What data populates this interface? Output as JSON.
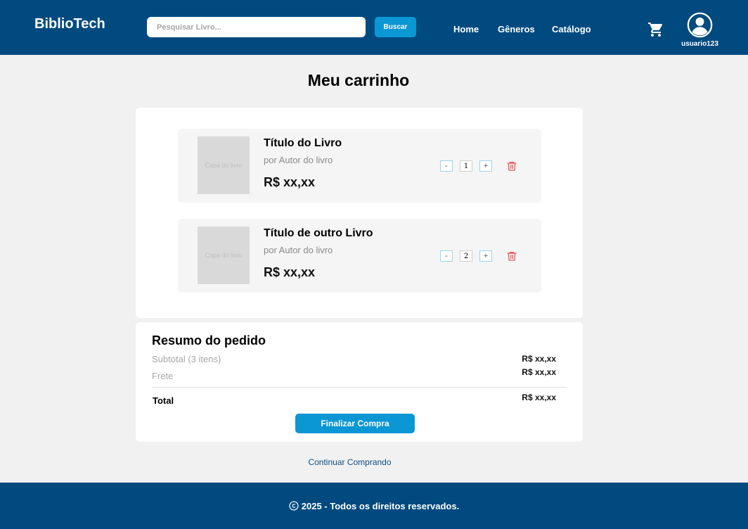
{
  "header": {
    "brand": "BiblioTech",
    "search_placeholder": "Pesquisar Livro...",
    "search_button": "Buscar",
    "nav": [
      {
        "label": "Home"
      },
      {
        "label": "Gêneros"
      },
      {
        "label": "Catálogo"
      }
    ],
    "username": "usuario123",
    "icons": {
      "cart": "cart-icon",
      "user": "user-circle-icon"
    }
  },
  "page_title": "Meu carrinho",
  "cart_items": [
    {
      "cover_text": "Capa do livro",
      "title": "Título do Livro",
      "author": "por Autor do livro",
      "price": "R$ xx,xx",
      "quantity": "1",
      "minus": "-",
      "plus": "+"
    },
    {
      "cover_text": "Capa do livro",
      "title": "Título de outro Livro",
      "author": "por Autor do livro",
      "price": "R$ xx,xx",
      "quantity": "2",
      "minus": "-",
      "plus": "+"
    }
  ],
  "summary": {
    "title": "Resumo do pedido",
    "subtotal_label": "Subtotal (3 itens)",
    "subtotal_value": "R$ xx,xx",
    "shipping_label": "Frete",
    "shipping_value": "R$ xx,xx",
    "total_label": "Total",
    "total_value": "R$ xx,xx",
    "finish_button": "Finalizar Compra"
  },
  "continue_link": "Continuar Comprando",
  "footer": {
    "text": "2025 - Todos os direitos reservados."
  },
  "colors": {
    "header_bg": "#004a80",
    "accent": "#0b97d4",
    "delete": "#e05a5a"
  }
}
